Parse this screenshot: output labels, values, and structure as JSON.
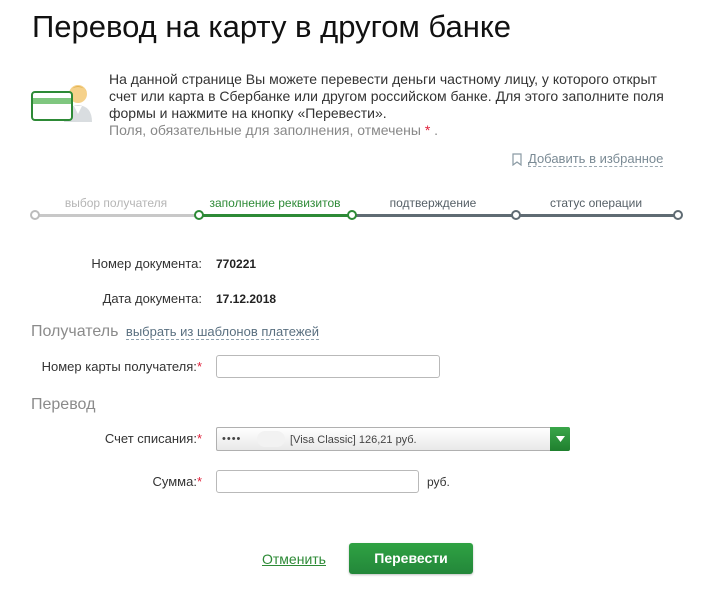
{
  "page": {
    "title": "Перевод на карту в другом банке"
  },
  "info": {
    "text": "На данной странице Вы можете перевести деньги частному лицу, у которого открыт счет или карта в Сбербанке или другом российском банке. Для этого заполните поля формы и нажмите на кнопку «Перевести».",
    "required_note": "Поля, обязательные для заполнения, отмечены",
    "required_star": "*",
    "required_end": "."
  },
  "favorites": {
    "label": "Добавить в избранное"
  },
  "steps": [
    {
      "label": "выбор получателя",
      "state": "done"
    },
    {
      "label": "заполнение реквизитов",
      "state": "active"
    },
    {
      "label": "подтверждение",
      "state": "todo"
    },
    {
      "label": "статус операции",
      "state": "todo"
    }
  ],
  "document": {
    "number_label": "Номер документа:",
    "number_value": "770221",
    "date_label": "Дата документа:",
    "date_value": "17.12.2018"
  },
  "recipient": {
    "section_title": "Получатель",
    "templates_link": "выбрать из шаблонов платежей",
    "card_label": "Номер карты получателя:",
    "card_value": "",
    "required_mark": "*"
  },
  "transfer": {
    "section_title": "Перевод",
    "account_label": "Счет списания:",
    "account_masked": "••••",
    "account_value": "[Visa Classic] 126,21  руб.",
    "amount_label": "Сумма:",
    "amount_value": "",
    "amount_unit": "руб.",
    "required_mark": "*"
  },
  "actions": {
    "cancel": "Отменить",
    "submit": "Перевести"
  },
  "colors": {
    "accent_green": "#2d8a36",
    "required_red": "#e0203a",
    "step_todo": "#5f6b73"
  }
}
